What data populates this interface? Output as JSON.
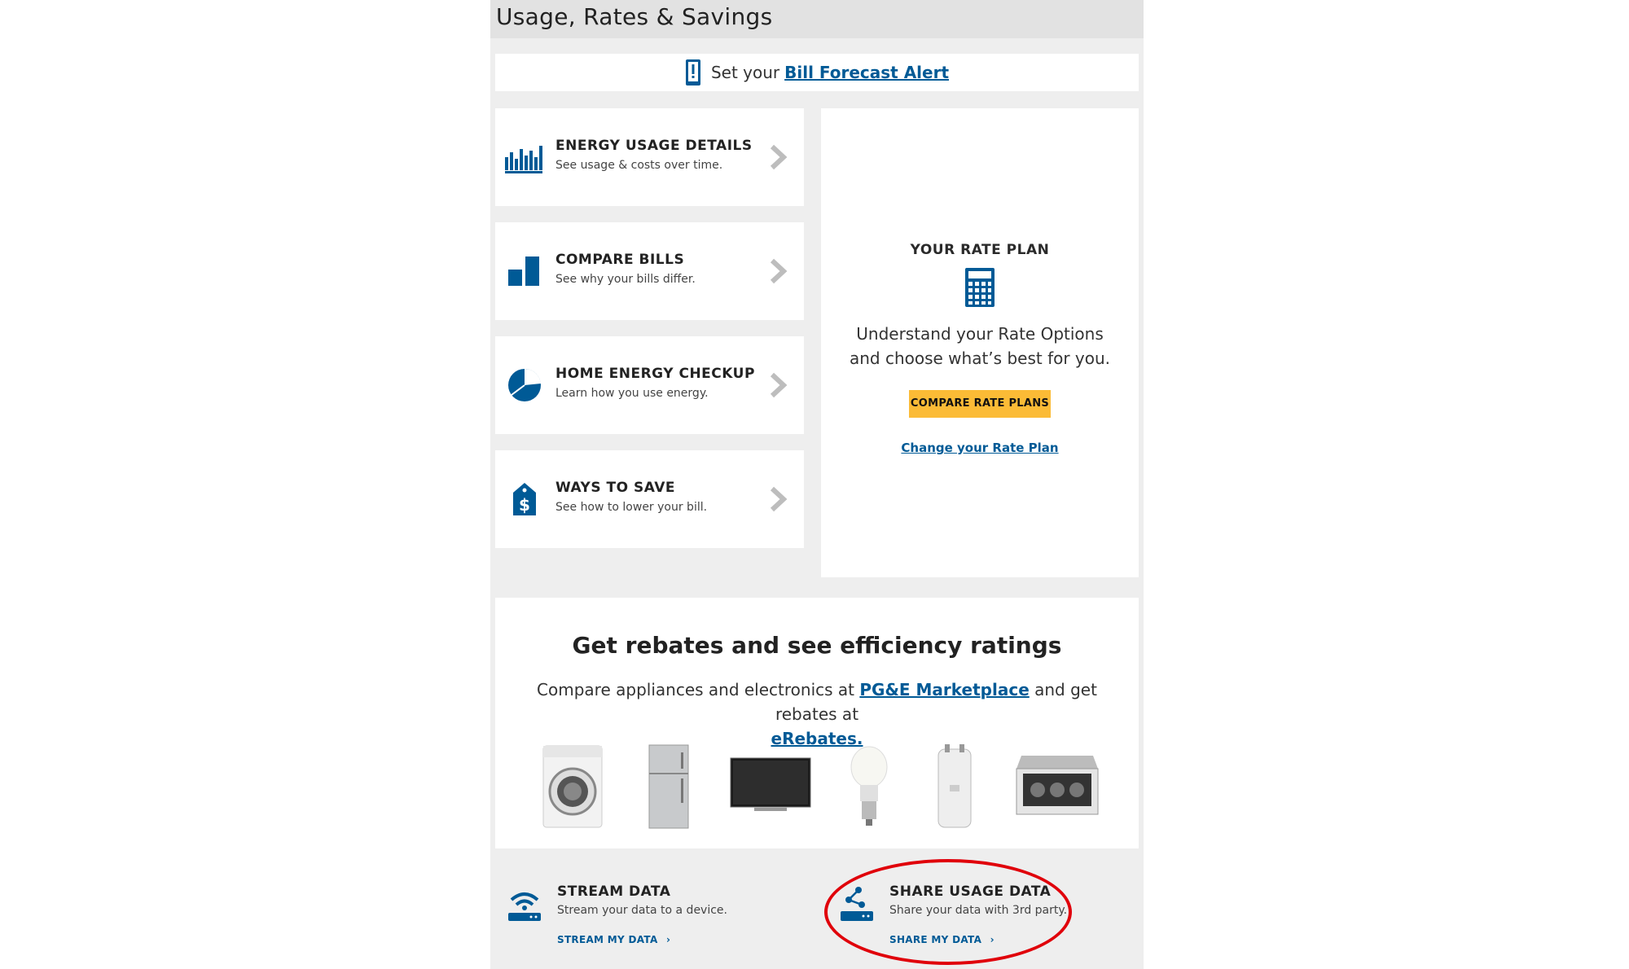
{
  "header": {
    "title": "Usage, Rates & Savings"
  },
  "forecast": {
    "prefix": "Set your",
    "link": "Bill Forecast Alert"
  },
  "cards": [
    {
      "title": "ENERGY USAGE DETAILS",
      "subtitle": "See usage & costs over time."
    },
    {
      "title": "COMPARE BILLS",
      "subtitle": "See why your bills differ."
    },
    {
      "title": "HOME ENERGY CHECKUP",
      "subtitle": "Learn how you use energy."
    },
    {
      "title": "WAYS TO SAVE",
      "subtitle": "See how to lower your bill."
    }
  ],
  "rate_plan": {
    "title": "YOUR RATE PLAN",
    "description": "Understand your Rate Options and choose what’s best for you.",
    "button": "COMPARE RATE PLANS",
    "link": "Change your Rate Plan"
  },
  "rebates": {
    "title": "Get rebates and see efficiency ratings",
    "desc_prefix": "Compare appliances and electronics at",
    "marketplace_link": "PG&E Marketplace",
    "desc_middle": "and get rebates at",
    "erebates_link": "eRebates."
  },
  "stream": {
    "title": "STREAM DATA",
    "subtitle": "Stream your data to a device.",
    "link": "STREAM MY DATA"
  },
  "share": {
    "title": "SHARE USAGE DATA",
    "subtitle": "Share your data with 3rd party.",
    "link": "SHARE MY DATA"
  },
  "colors": {
    "accent": "#005a96",
    "button": "#fbbb36",
    "highlight_circle": "#e0000a"
  }
}
